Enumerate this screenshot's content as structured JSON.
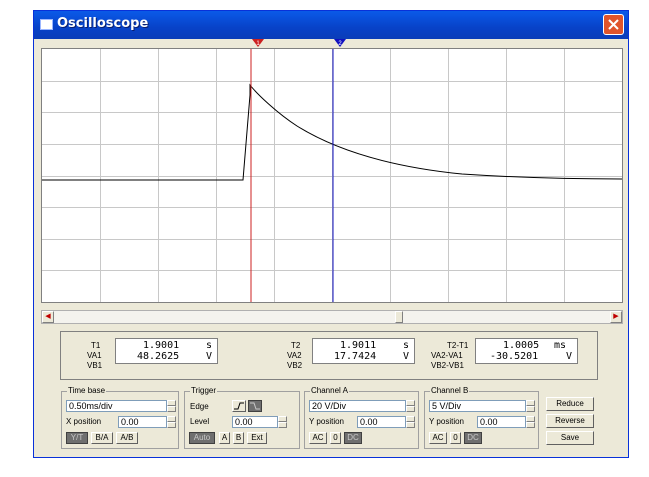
{
  "window": {
    "title": "Oscilloscope"
  },
  "cursors": {
    "c1_label": "1",
    "c2_label": "2"
  },
  "measurements": {
    "t1": {
      "name": "T1",
      "value": "1.9001",
      "unit": "s"
    },
    "va1": {
      "name": "VA1",
      "value": "48.2625",
      "unit": "V"
    },
    "vb1": {
      "name": "VB1"
    },
    "t2": {
      "name": "T2",
      "value": "1.9011",
      "unit": "s"
    },
    "va2": {
      "name": "VA2",
      "value": "17.7424",
      "unit": "V"
    },
    "vb2": {
      "name": "VB2"
    },
    "dt": {
      "name": "T2-T1",
      "value": "1.0005",
      "unit": "ms"
    },
    "dva": {
      "name": "VA2-VA1",
      "value": "-30.5201",
      "unit": "V"
    },
    "dvb": {
      "name": "VB2-VB1"
    }
  },
  "timebase": {
    "label": "Time base",
    "scale": "0.50ms/div",
    "xpos_label": "X position",
    "xpos": "0.00",
    "modes": [
      "Y/T",
      "B/A",
      "A/B"
    ]
  },
  "trigger": {
    "label": "Trigger",
    "edge_label": "Edge",
    "level_label": "Level",
    "level": "0.00",
    "sources": [
      "Auto",
      "A",
      "B",
      "Ext"
    ]
  },
  "channel_a": {
    "label": "Channel A",
    "scale": "20 V/Div",
    "ypos_label": "Y position",
    "ypos": "0.00",
    "coupling": [
      "AC",
      "0",
      "DC"
    ]
  },
  "channel_b": {
    "label": "Channel B",
    "scale": "5 V/Div",
    "ypos_label": "Y position",
    "ypos": "0.00",
    "coupling": [
      "AC",
      "0",
      "DC"
    ]
  },
  "actions": {
    "reduce": "Reduce",
    "reverse": "Reverse",
    "save": "Save"
  },
  "colors": {
    "cursor1": "#cc2020",
    "cursor2": "#1010c0",
    "trace": "#000000",
    "grid": "#c8c8c8"
  }
}
